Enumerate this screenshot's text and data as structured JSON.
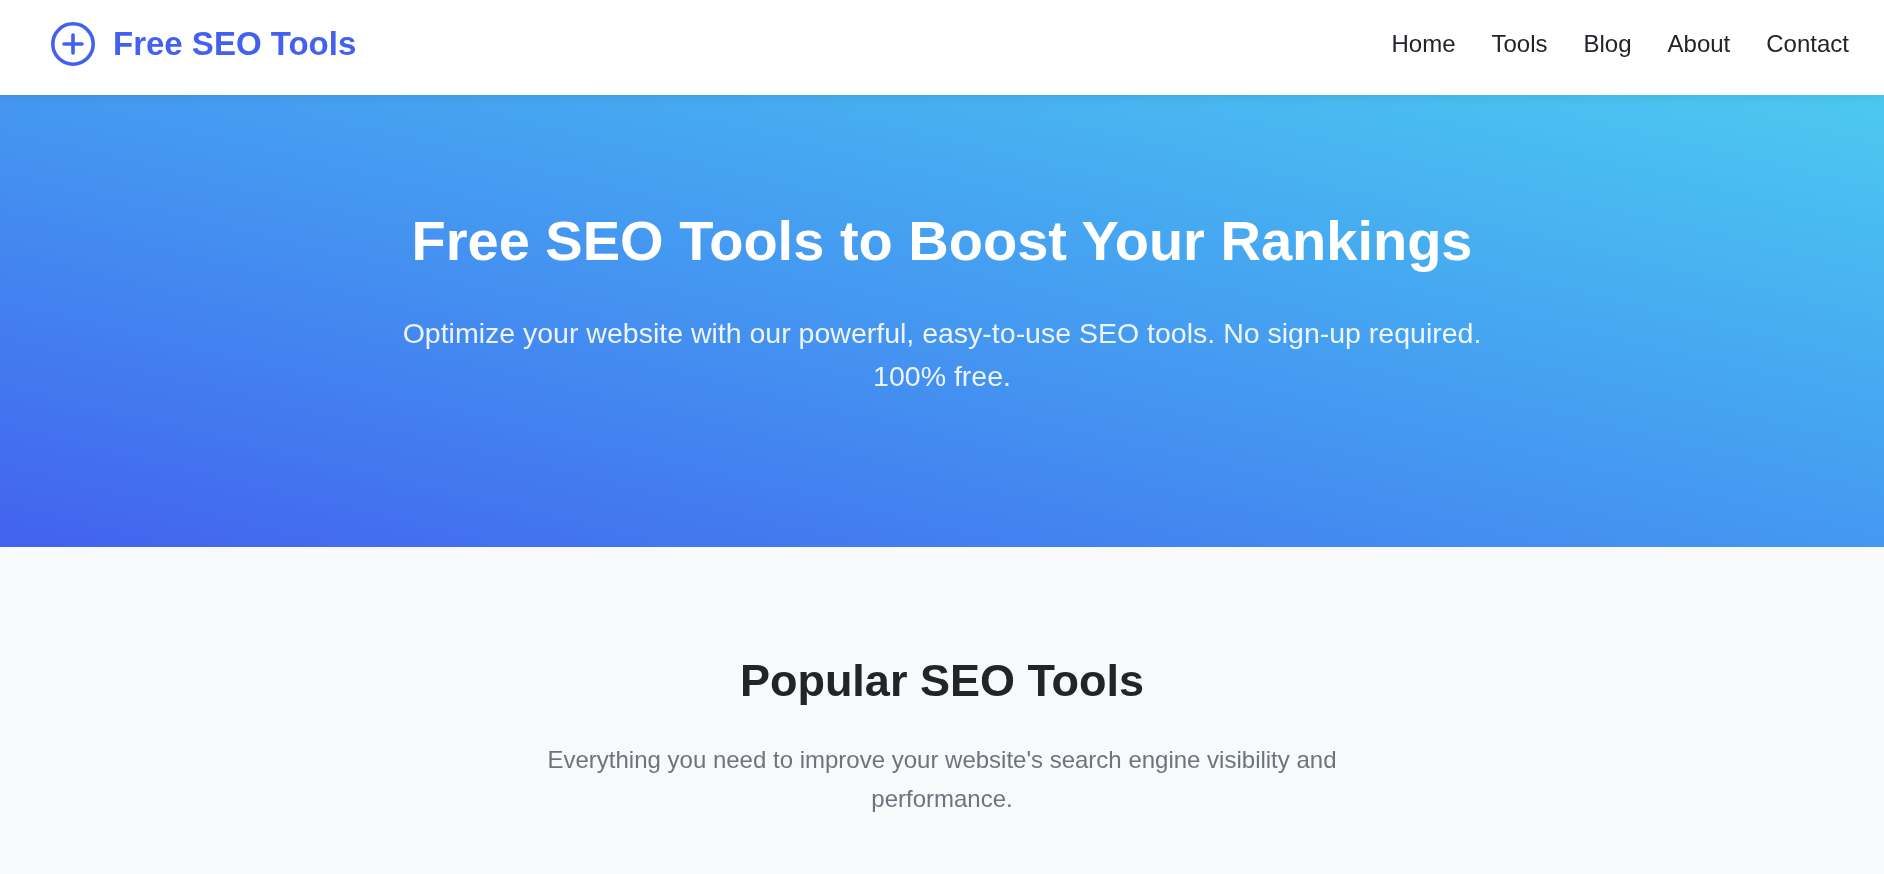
{
  "header": {
    "logo": {
      "text": "Free SEO Tools"
    },
    "nav": [
      {
        "label": "Home"
      },
      {
        "label": "Tools"
      },
      {
        "label": "Blog"
      },
      {
        "label": "About"
      },
      {
        "label": "Contact"
      }
    ]
  },
  "hero": {
    "title": "Free SEO Tools to Boost Your Rankings",
    "subtitle": "Optimize your website with our powerful, easy-to-use SEO tools. No sign-up required. 100% free."
  },
  "tools_section": {
    "title": "Popular SEO Tools",
    "description": "Everything you need to improve your website's search engine visibility and performance."
  }
}
